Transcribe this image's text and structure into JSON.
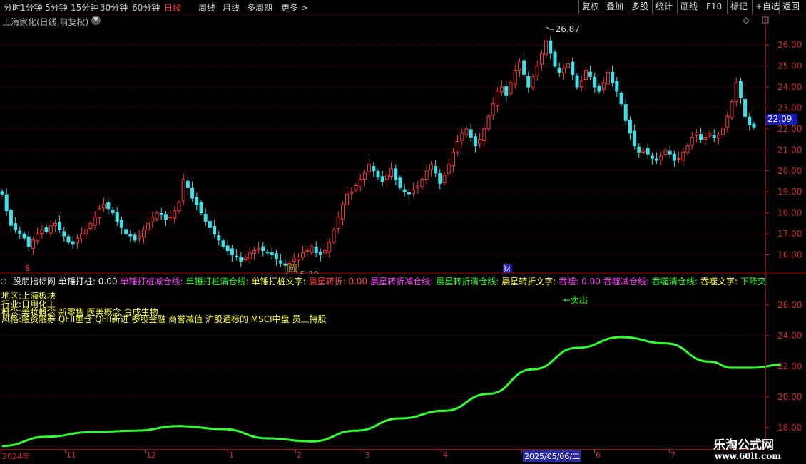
{
  "toolbar": {
    "periods": [
      "分时",
      "1分钟",
      "5分钟",
      "15分钟",
      "30分钟",
      "60分钟",
      "日线",
      "周线",
      "月线",
      "多周期",
      "更多 >"
    ],
    "active_period": "日线",
    "buttons": [
      "复权",
      "叠加",
      "多股",
      "统计",
      "画线",
      "F10",
      "标记",
      "+自选",
      "返回"
    ]
  },
  "stock_title": "上海家化(日线,前复权)",
  "current_price": "22.09",
  "colors": {
    "up": "#ff3b3b",
    "down": "#3fe0e8",
    "grid": "#8a0000",
    "axis_text": "#d03030",
    "ma_line": "#33ff33",
    "background": "#000000"
  },
  "main_chart": {
    "price_axis": [
      "26.00",
      "25.00",
      "24.00",
      "23.00",
      "22.00",
      "21.00",
      "20.00",
      "19.00",
      "18.00",
      "17.00",
      "16.00"
    ],
    "ylim": [
      15.1,
      27.4
    ],
    "high_label": "26.87",
    "low_label": "15.30",
    "markers": {
      "s": "S",
      "hui": "回",
      "cai": "财"
    }
  },
  "indicator": {
    "name": "股朋指标网",
    "header_items": [
      {
        "text": "单锤打桩: 0.00",
        "color": "#ffffff"
      },
      {
        "text": "单锤打桩减仓线:",
        "color": "#ff44ff"
      },
      {
        "text": "单锤打桩清仓线:",
        "color": "#33ff33"
      },
      {
        "text": "单锤打桩文字:",
        "color": "#ffff3c"
      },
      {
        "text": "晨星转折: 0.00",
        "color": "#ff4444"
      },
      {
        "text": "晨星转折减仓线:",
        "color": "#ff44ff"
      },
      {
        "text": "晨星转折清仓线:",
        "color": "#33ff33"
      },
      {
        "text": "晨星转折文字:",
        "color": "#ffff3c"
      },
      {
        "text": "吞噬: 0.00",
        "color": "#ff44ff"
      },
      {
        "text": "吞噬减仓线:",
        "color": "#ff44ff"
      },
      {
        "text": "吞噬清仓线:",
        "color": "#33ff33"
      },
      {
        "text": "吞噬文字:",
        "color": "#ffff3c"
      },
      {
        "text": "下降突破",
        "color": "#33ff33"
      }
    ],
    "region": "地区:上海板块",
    "industry": "行业:日用化工",
    "concept": "概念:美妆概念 新零售 医美概念 合成生物",
    "style": "风格:融资融券 QFII重仓 QFII新进 参股金融 商誉减值 沪股通标的 MSCI中盘 员工持股",
    "sell_label": "←卖出",
    "price_axis": [
      "26.00",
      "24.00",
      "22.00",
      "20.00",
      "18.00"
    ],
    "ylim": [
      16.6,
      27.2
    ]
  },
  "date_axis": [
    {
      "label": "2024年",
      "hl": false
    },
    {
      "label": "11",
      "hl": false
    },
    {
      "label": "12",
      "hl": false
    },
    {
      "label": "1",
      "hl": false
    },
    {
      "label": "2",
      "hl": false
    },
    {
      "label": "3",
      "hl": false
    },
    {
      "label": "4",
      "hl": false
    },
    {
      "label": "2025/05/06/二",
      "hl": true
    },
    {
      "label": "6",
      "hl": false
    },
    {
      "label": "7",
      "hl": false
    }
  ],
  "watermark": {
    "cn": "乐淘公式网",
    "url": "www.60lt.com"
  },
  "chart_data": {
    "type": "candlestick",
    "ylim": [
      15.1,
      27.4
    ],
    "closes": [
      18.9,
      18.1,
      17.4,
      17.2,
      17.0,
      16.8,
      16.4,
      16.7,
      17.0,
      17.2,
      17.1,
      17.4,
      17.5,
      17.2,
      16.9,
      16.6,
      16.5,
      16.8,
      17.0,
      17.2,
      17.5,
      17.8,
      18.2,
      18.4,
      18.2,
      18.0,
      17.6,
      17.3,
      17.0,
      16.9,
      16.7,
      16.9,
      17.2,
      17.5,
      17.8,
      18.0,
      17.9,
      17.7,
      17.8,
      18.1,
      18.5,
      19.6,
      19.2,
      18.7,
      18.4,
      18.0,
      17.6,
      17.3,
      17.0,
      16.7,
      16.4,
      16.2,
      16.0,
      15.9,
      15.7,
      15.9,
      16.1,
      16.2,
      16.3,
      16.2,
      16.1,
      16.0,
      15.8,
      15.6,
      15.5,
      15.6,
      15.8,
      15.9,
      16.1,
      16.2,
      16.4,
      16.1,
      16.0,
      16.2,
      16.6,
      17.2,
      17.8,
      18.4,
      18.9,
      19.0,
      19.3,
      19.6,
      19.9,
      20.3,
      20.0,
      19.7,
      19.5,
      19.8,
      20.1,
      19.6,
      19.2,
      19.0,
      18.9,
      19.1,
      19.3,
      19.6,
      20.0,
      20.3,
      19.9,
      19.4,
      19.8,
      20.3,
      20.9,
      21.4,
      21.8,
      22.0,
      21.6,
      21.2,
      21.5,
      22.0,
      22.6,
      23.2,
      23.8,
      24.0,
      23.6,
      24.2,
      24.8,
      25.2,
      24.6,
      24.0,
      24.5,
      25.0,
      25.6,
      26.2,
      25.6,
      25.0,
      24.7,
      24.9,
      25.1,
      24.6,
      24.0,
      24.3,
      24.8,
      24.5,
      24.0,
      23.8,
      24.2,
      24.7,
      24.2,
      23.8,
      23.2,
      22.4,
      21.8,
      21.2,
      20.9,
      21.0,
      20.8,
      20.6,
      20.5,
      20.7,
      21.0,
      20.8,
      20.5,
      20.6,
      20.9,
      21.2,
      21.6,
      21.8,
      21.5,
      21.6,
      21.8,
      21.6,
      21.7,
      22.0,
      22.6,
      23.3,
      24.2,
      23.5,
      22.6,
      22.2,
      22.09
    ],
    "ma_line": {
      "x": [
        0,
        10,
        20,
        30,
        40,
        50,
        60,
        70,
        80,
        90,
        100,
        110,
        120,
        130,
        140,
        150,
        160,
        165,
        170,
        176
      ],
      "y": [
        16.8,
        17.4,
        17.7,
        17.8,
        18.1,
        17.9,
        17.3,
        17.1,
        17.8,
        18.6,
        19.1,
        20.2,
        21.8,
        23.2,
        23.9,
        23.5,
        22.3,
        21.9,
        21.9,
        22.1
      ]
    }
  }
}
